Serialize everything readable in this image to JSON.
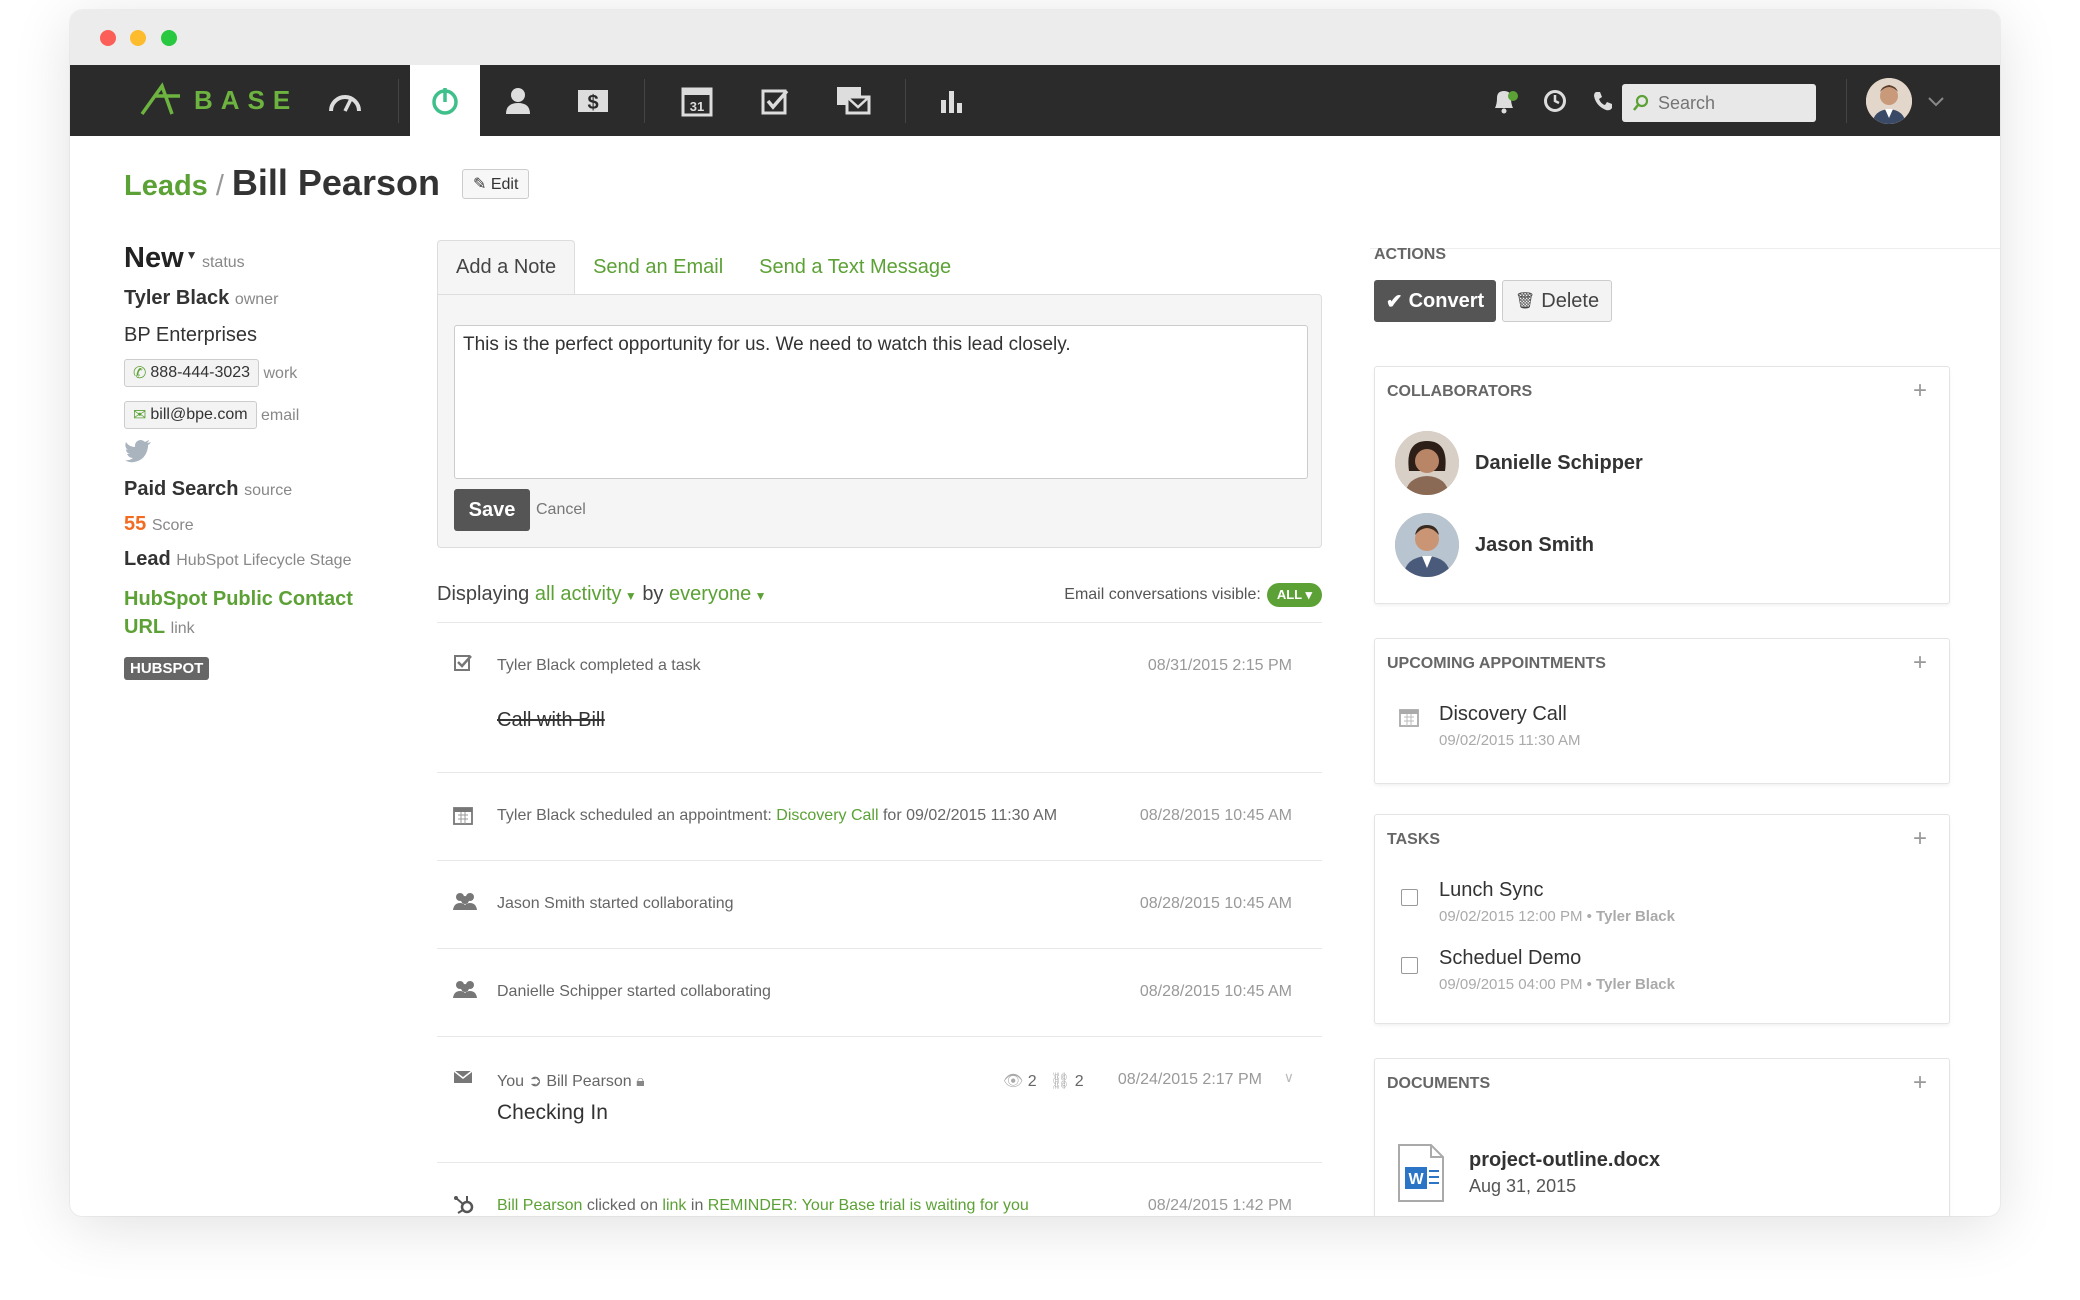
{
  "nav": {
    "logo_text": "BASE",
    "search_placeholder": "Search"
  },
  "header": {
    "breadcrumb_link": "Leads",
    "separator": "/",
    "title": "Bill Pearson",
    "edit_label": "Edit"
  },
  "lead": {
    "status_value": "New",
    "status_label": "status",
    "owner_name": "Tyler Black",
    "owner_label": "owner",
    "company": "BP Enterprises",
    "phone": "888-444-3023",
    "phone_label": "work",
    "email": "bill@bpe.com",
    "email_label": "email",
    "source_value": "Paid Search",
    "source_label": "source",
    "score_value": "55",
    "score_label": "Score",
    "stage_value": "Lead",
    "stage_label": "HubSpot Lifecycle Stage",
    "hubspot_link_line1": "HubSpot Public Contact",
    "hubspot_link_line2": "URL",
    "hubspot_link_label": "link",
    "hubspot_badge": "HUBSPOT"
  },
  "composer": {
    "tabs": [
      "Add a Note",
      "Send an Email",
      "Send a Text Message"
    ],
    "note_text": "This is the perfect opportunity for us. We need to watch this lead closely.",
    "save_label": "Save",
    "cancel_label": "Cancel"
  },
  "filter": {
    "prefix": "Displaying",
    "activity": "all activity",
    "by": "by",
    "who": "everyone",
    "email_visible_label": "Email conversations visible:",
    "email_visible_value": "ALL"
  },
  "feed": [
    {
      "text": "Tyler Black completed a task",
      "time": "08/31/2015 2:15 PM",
      "detail": "Call with Bill"
    },
    {
      "text_pre": "Tyler Black scheduled an appointment: ",
      "link": "Discovery Call",
      "text_post": " for 09/02/2015 11:30 AM",
      "time": "08/28/2015 10:45 AM"
    },
    {
      "text": "Jason Smith started collaborating",
      "time": "08/28/2015 10:45 AM"
    },
    {
      "text": "Danielle Schipper started collaborating",
      "time": "08/28/2015 10:45 AM"
    },
    {
      "from": "You",
      "to": "Bill Pearson",
      "views": "2",
      "links": "2",
      "time": "08/24/2015 2:17 PM",
      "subject": "Checking In"
    },
    {
      "who": "Bill Pearson",
      "mid1": " clicked on ",
      "link": "link",
      "mid2": " in ",
      "campaign": "REMINDER: Your Base trial is waiting for you",
      "time": "08/24/2015 1:42 PM"
    }
  ],
  "actions": {
    "label": "ACTIONS",
    "convert_label": "Convert",
    "delete_label": "Delete"
  },
  "collaborators": {
    "title": "COLLABORATORS",
    "people": [
      "Danielle Schipper",
      "Jason Smith"
    ]
  },
  "appointments": {
    "title": "UPCOMING APPOINTMENTS",
    "items": [
      {
        "title": "Discovery Call",
        "when": "09/02/2015 11:30 AM"
      }
    ]
  },
  "tasks": {
    "title": "TASKS",
    "items": [
      {
        "title": "Lunch Sync",
        "when": "09/02/2015 12:00 PM",
        "sep": " • ",
        "who": "Tyler Black"
      },
      {
        "title": "Scheduel Demo",
        "when": "09/09/2015 04:00 PM",
        "sep": " • ",
        "who": "Tyler Black"
      }
    ]
  },
  "documents": {
    "title": "DOCUMENTS",
    "items": [
      {
        "name": "project-outline.docx",
        "date": "Aug 31, 2015"
      }
    ]
  },
  "colors": {
    "brand_green": "#5ca135",
    "navbar": "#2b2b2b",
    "score_orange": "#f26b21"
  }
}
